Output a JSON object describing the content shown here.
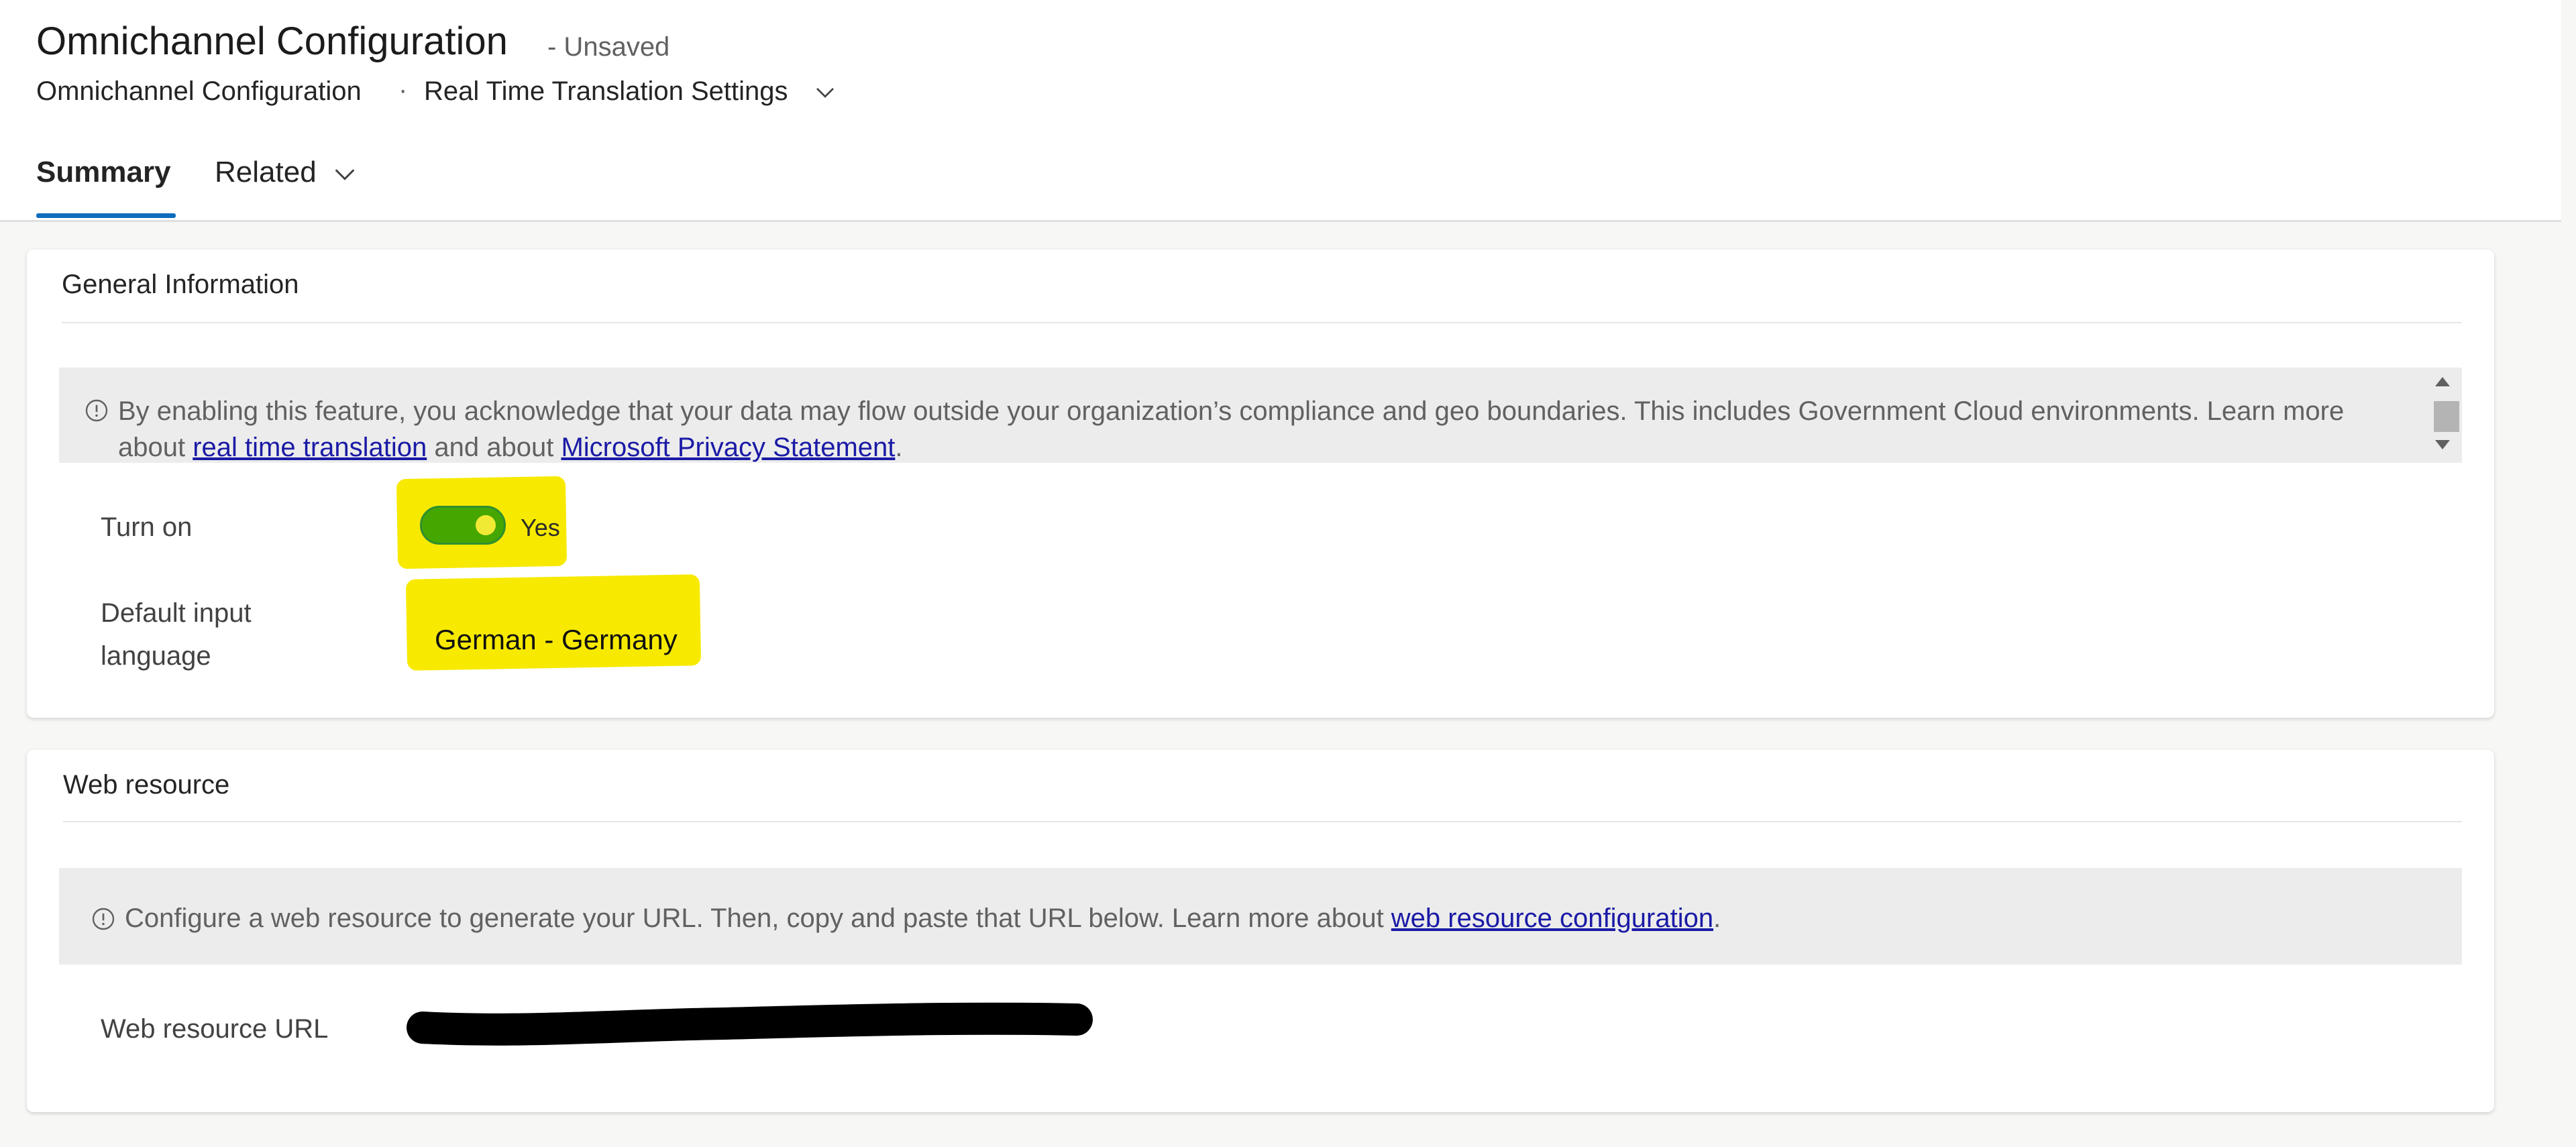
{
  "header": {
    "title": "Omnichannel Configuration",
    "status": "- Unsaved",
    "breadcrumb_entity": "Omnichannel Configuration",
    "breadcrumb_separator": "·",
    "form_name": "Real Time Translation Settings"
  },
  "tabs": [
    {
      "label": "Summary",
      "selected": true
    },
    {
      "label": "Related",
      "selected": false
    }
  ],
  "general_info": {
    "title": "General Information",
    "notice": {
      "text_before": "By enabling this feature, you acknowledge that your data may flow outside your organization’s compliance and geo boundaries. This includes Government Cloud environments. Learn more about ",
      "link1": "real time translation",
      "text_middle": " and about ",
      "link2": "Microsoft Privacy Statement",
      "text_after": "."
    },
    "turn_on": {
      "label": "Turn on",
      "value": "Yes",
      "checked": true
    },
    "default_language": {
      "label": "Default input language",
      "value": "German - Germany"
    }
  },
  "web_resource": {
    "title": "Web resource",
    "notice": {
      "text_before": "Configure a web resource to generate your URL. Then, copy and paste that URL below. Learn more about ",
      "link": "web resource configuration",
      "text_after": "."
    },
    "url_field": {
      "label": "Web resource URL"
    }
  },
  "colors": {
    "accent": "#0f6cbd",
    "toggle_on": "#46a600",
    "highlight": "#f7ea00",
    "link": "#1a1aa6",
    "notice_bg": "#ececec",
    "redaction": "#000000"
  },
  "icons": {
    "info": "info-circle-icon",
    "chevron": "chevron-down-icon"
  }
}
